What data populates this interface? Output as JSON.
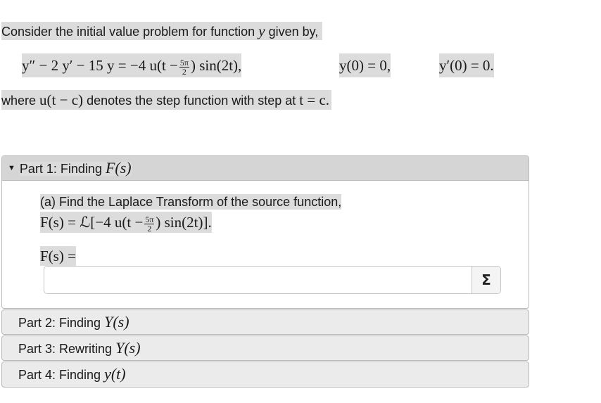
{
  "intro": {
    "prefix": "Consider the initial value problem for function",
    "var": "y",
    "suffix": "given by,"
  },
  "equation": {
    "lhs": "y″ − 2 y′ − 15 y = −4 u(t −",
    "frac_num": "5π",
    "frac_den": "2",
    "rhs": ") sin(2t),",
    "ic1": "y(0) = 0,",
    "ic2": "y′(0) = 0."
  },
  "where": {
    "prefix": "where",
    "expr": "u(t − c)",
    "middle": "denotes the step function with step at",
    "cond": "t = c."
  },
  "parts": [
    {
      "label": "Part 1: Finding",
      "math": "F(s)",
      "expanded": true
    },
    {
      "label": "Part 2: Finding",
      "math": "Y(s)",
      "expanded": false
    },
    {
      "label": "Part 3: Rewriting",
      "math": "Y(s)",
      "expanded": false
    },
    {
      "label": "Part 4: Finding",
      "math": "y(t)",
      "expanded": false
    }
  ],
  "part1": {
    "question": "(a) Find the Laplace Transform of the source function,",
    "formula_lhs": "F(s) = ℒ[−4 u(t −",
    "frac_num": "5π",
    "frac_den": "2",
    "formula_rhs": ") sin(2t)].",
    "answer_label": "F(s) =",
    "answer_value": "",
    "answer_placeholder": "",
    "sigma_label": "Σ",
    "caret_icon": "caret-down-icon"
  }
}
